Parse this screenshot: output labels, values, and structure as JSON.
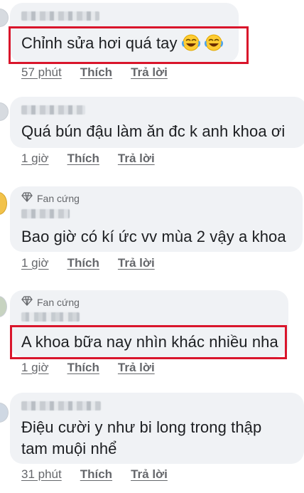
{
  "comments": [
    {
      "text": "Chỉnh sửa hơi quá tay",
      "emoji": "joy-emoji",
      "time": "57 phút",
      "like": "Thích",
      "reply": "Trả lời"
    },
    {
      "text": "Quá bún đậu làm ăn đc k anh khoa ơi",
      "time": "1 giờ",
      "like": "Thích",
      "reply": "Trả lời"
    },
    {
      "badge": "Fan cứng",
      "text": "Bao giờ có kí ức vv mùa 2 vậy a khoa",
      "time": "1 giờ",
      "like": "Thích",
      "reply": "Trả lời"
    },
    {
      "badge": "Fan cứng",
      "text": "A khoa bữa nay nhìn khác nhiều nha",
      "time": "1 giờ",
      "like": "Thích",
      "reply": "Trả lời"
    },
    {
      "text_line1": "Điệu cười y như bi long trong thập",
      "text_line2": "tam muội nhể",
      "time": "31 phút",
      "like": "Thích",
      "reply": "Trả lời"
    }
  ],
  "colors": {
    "highlight": "#d9152b",
    "bubble": "#f0f2f5",
    "meta": "#65676b"
  },
  "icons": {
    "badge": "diamond-icon"
  }
}
